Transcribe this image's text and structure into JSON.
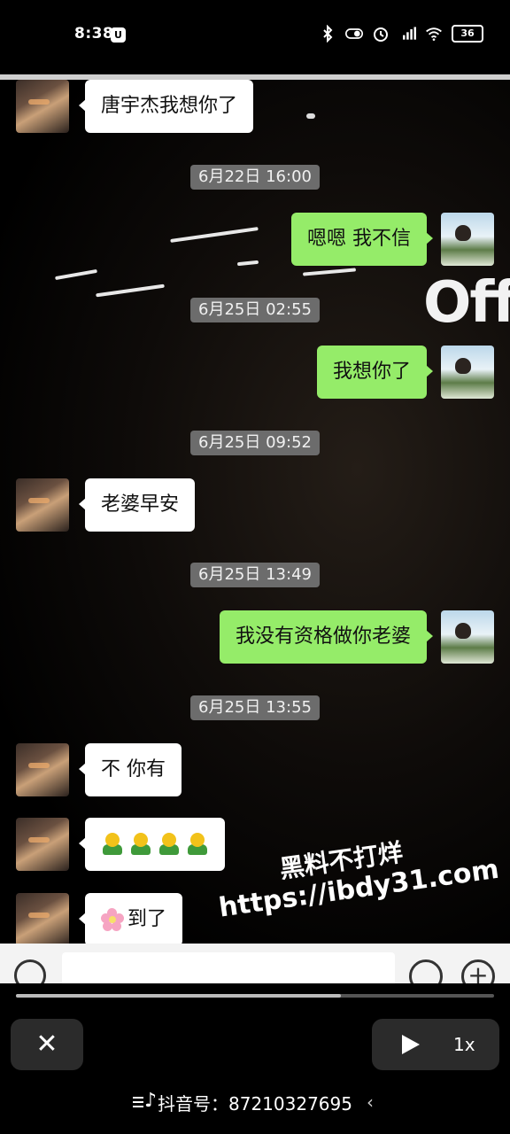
{
  "status_bar": {
    "time": "8:38",
    "battery": "36"
  },
  "chat": {
    "messages": [
      {
        "side": "in",
        "text": "唐宇杰我想你了"
      },
      {
        "timestamp": "6月22日 16:00"
      },
      {
        "side": "out",
        "text": "嗯嗯 我不信"
      },
      {
        "timestamp": "6月25日 02:55"
      },
      {
        "side": "out",
        "text": "我想你了"
      },
      {
        "timestamp": "6月25日 09:52"
      },
      {
        "side": "in",
        "text": "老婆早安"
      },
      {
        "timestamp": "6月25日 13:49"
      },
      {
        "side": "out",
        "text": "我没有资格做你老婆"
      },
      {
        "timestamp": "6月25日 13:55"
      },
      {
        "side": "in",
        "text": "不 你有"
      },
      {
        "side": "in",
        "emoji": "hugging-face-x4"
      },
      {
        "side": "in",
        "text": "到了",
        "prefix_emoji": "cherry-blossom"
      }
    ],
    "background_sign": "Off-"
  },
  "watermark": {
    "line1": "黑料不打烊",
    "line2": "https://ibdy31.com"
  },
  "player": {
    "progress": 0.68,
    "speed_label": "1x",
    "close_label": "✕",
    "douyin_label": "抖音号：",
    "douyin_id": "87210327695"
  }
}
